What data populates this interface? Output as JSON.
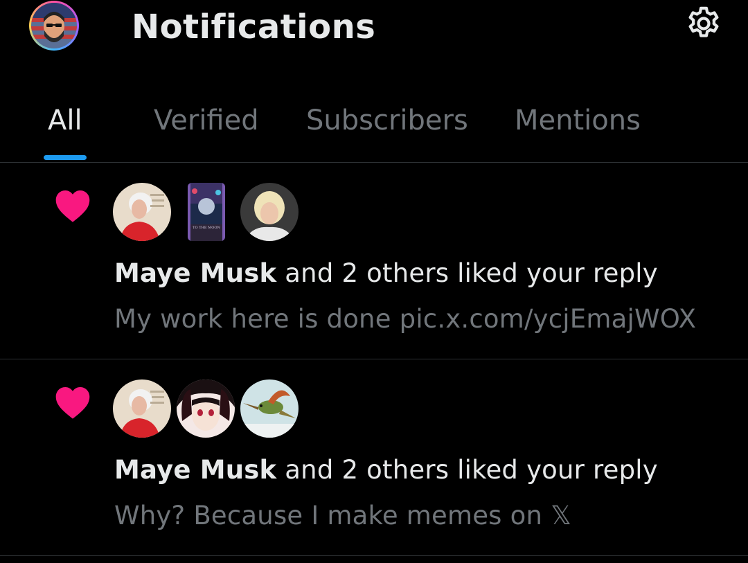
{
  "header": {
    "title": "Notifications",
    "avatar_icon": "user-avatar-icon",
    "settings_icon": "gear-icon"
  },
  "tabs": [
    {
      "label": "All",
      "active": true
    },
    {
      "label": "Verified",
      "active": false
    },
    {
      "label": "Subscribers",
      "active": false
    },
    {
      "label": "Mentions",
      "active": false
    }
  ],
  "colors": {
    "background": "#000000",
    "text_primary": "#e7e9ea",
    "text_secondary": "#71767b",
    "accent": "#1d9bf0",
    "like": "#f91880",
    "divider": "#2f3336"
  },
  "notifications": [
    {
      "icon": "heart-icon",
      "actor": "Maye Musk",
      "action": " and 2 others liked your reply",
      "snippet": "My work here is done pic.x.com/ycjEmajWOX",
      "book_cover_text": "TO THE MOON"
    },
    {
      "icon": "heart-icon",
      "actor": "Maye Musk",
      "action": " and 2 others liked your reply",
      "snippet": "Why? Because I make memes on 𝕏"
    }
  ]
}
